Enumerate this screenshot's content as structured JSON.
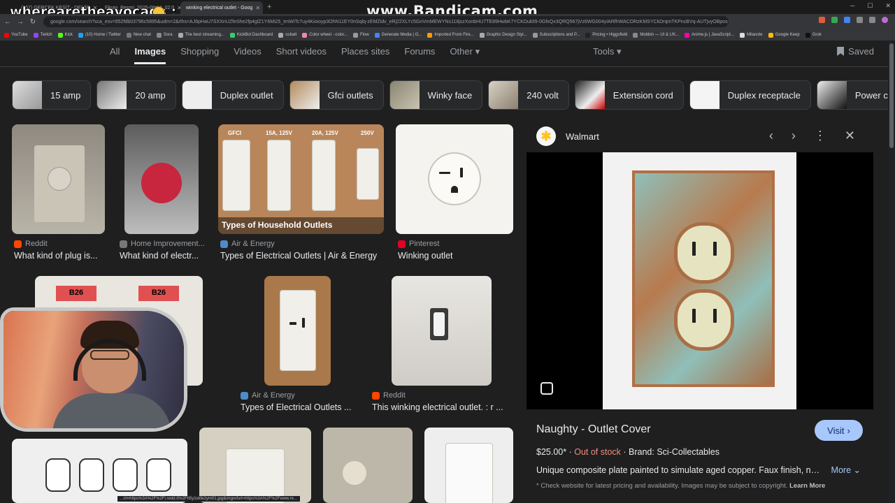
{
  "browser": {
    "tabs": [
      {
        "title": "(157) GERÇEK KESİT - DEMİR",
        "active": false
      },
      {
        "title": "Ekran_Resmi_2025-08-14_02:0",
        "active": false
      },
      {
        "title": "winking electrical outlet - Goog",
        "active": true
      }
    ],
    "url": "google.com/search?sca_esv=952fdb03796c5895&udm=2&rlhs=AJ6pHaU7SXXnUZfeShe2fp4glZ1Y6Mi25_tmWiTc7uy4Kioioyp3OhN11EY0nSqlq-zEMZidv_eRj22XLYc5GnVmMEWYNs118jszXonbHU7TE89HwbK7YCKDuklI9-0GfxQx3QRQ567jVz6WG004yIARfhWACORzKMSYCkDrqmTKPncBVq-AUTjvyOBpos_1ntg...",
    "bookmarks": [
      "YouTube",
      "Twitch",
      "Kick",
      "(10) Home / Twitter",
      "New chat",
      "Sora",
      "The best streaming...",
      "KickBot Dashboard",
      "cobalt",
      "Color wheel - color...",
      "Flow",
      "Generate Media | G...",
      "Imported From Fire...",
      "Graphic Design Styl...",
      "Subscriptions and P...",
      "Pricing • Higgsfield",
      "Mobbin — UI & UX...",
      "Anime.js | JavaScript...",
      "Milanote",
      "Google Keep",
      "Grok"
    ],
    "watermark": "www.Bandicam.com",
    "overlay_name": "wherearetheavocads :"
  },
  "search_nav": {
    "tabs": [
      "All",
      "Images",
      "Shopping",
      "Videos",
      "Short videos",
      "Places sites",
      "Forums",
      "Other"
    ],
    "active": "Images",
    "tools": "Tools",
    "saved": "Saved"
  },
  "chips": [
    "15 amp",
    "20 amp",
    "Duplex outlet",
    "Gfci outlets",
    "Winky face",
    "240 volt",
    "Extension cord",
    "Duplex receptacle",
    "Power cord"
  ],
  "results": [
    {
      "source": "Reddit",
      "caption": "What kind of plug is..."
    },
    {
      "source": "Home Improvement...",
      "caption": "What kind of electr..."
    },
    {
      "source": "Air & Energy",
      "caption": "Types of Electrical Outlets | Air & Energy",
      "overlay": "Types of Household Outlets",
      "labels": [
        "GFCI",
        "15A, 125V",
        "20A, 125V",
        "250V"
      ]
    },
    {
      "source": "Pinterest",
      "caption": "Winking outlet"
    },
    {
      "source": "Air & Energy",
      "caption": "Types of Electrical Outlets ..."
    },
    {
      "source": "Reddit",
      "caption": "This winking electrical outlet. : r ..."
    },
    {
      "tag": "B26"
    }
  ],
  "panel": {
    "source": "Walmart",
    "title": "Naughty - Outlet Cover",
    "visit": "Visit",
    "price": "$25.00*",
    "stock": "Out of stock",
    "brand": "Brand: Sci-Collectables",
    "description": "Unique composite plate painted to simulate aged copper. Faux finish, not...",
    "more": "More",
    "disclaimer": "* Check website for latest pricing and availability. Images may be subject to copyright.",
    "learn_more": "Learn More"
  },
  "status_url": "...irl=https%3A%2F%2Fi.redd.it%2Fh5y1vkfe2ym01.jpg&imgrefurl=https%3A%2F%2Fwww.re...",
  "colors": {
    "bg": "#1f1f1f",
    "accent": "#a8c7fa",
    "out_of_stock": "#f28b82",
    "walmart_spark": "#ffc220"
  }
}
